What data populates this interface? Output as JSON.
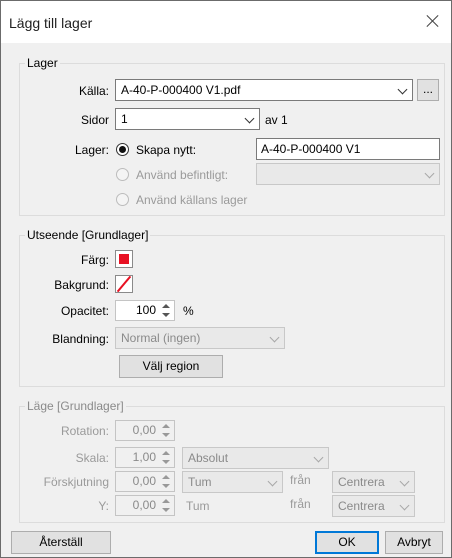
{
  "dialog": {
    "title": "Lägg till lager"
  },
  "lager": {
    "legend": "Lager",
    "source_label": "Källa:",
    "source_value": "A-40-P-000400 V1.pdf",
    "browse_label": "...",
    "pages_label": "Sidor",
    "pages_value": "1",
    "pages_of": "av 1",
    "layer_label": "Lager:",
    "create_new_label": "Skapa nytt:",
    "create_new_value": "A-40-P-000400 V1",
    "use_existing_label": "Använd befintligt:",
    "use_existing_value": "",
    "use_source_label": "Använd källans lager"
  },
  "appearance": {
    "legend": "Utseende [Grundlager]",
    "color_label": "Färg:",
    "background_label": "Bakgrund:",
    "opacity_label": "Opacitet:",
    "opacity_value": "100",
    "opacity_unit": "%",
    "blend_label": "Blandning:",
    "blend_value": "Normal (ingen)",
    "select_region_label": "Välj region",
    "color_hex": "#e81123",
    "background_hex": "#e81123"
  },
  "position": {
    "legend": "Läge [Grundlager]",
    "rotation_label": "Rotation:",
    "rotation_value": "0,00",
    "scale_label": "Skala:",
    "scale_value": "1,00",
    "scale_mode": "Absolut",
    "offset_label": "Förskjutning",
    "offset_x_value": "0,00",
    "offset_x_unit": "Tum",
    "offset_x_from": "från",
    "offset_x_anchor": "Centrera",
    "y_label": "Y:",
    "offset_y_value": "0,00",
    "offset_y_unit": "Tum",
    "offset_y_from": "från",
    "offset_y_anchor": "Centrera"
  },
  "footer": {
    "reset_label": "Återställ",
    "ok_label": "OK",
    "cancel_label": "Avbryt"
  }
}
